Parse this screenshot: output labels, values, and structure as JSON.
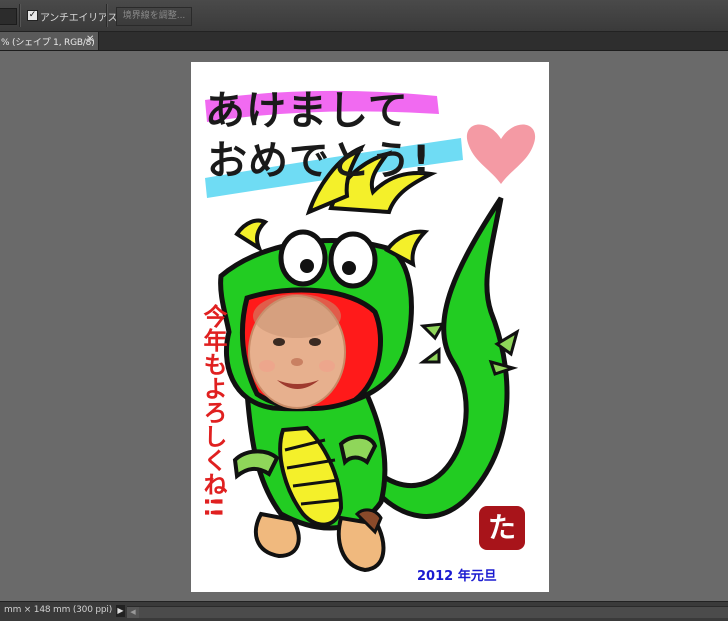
{
  "options_bar": {
    "antialias_checked": "✓",
    "antialias_label": "アンチエイリアス",
    "refine_edge_label": "境界線を調整..."
  },
  "document_tab": {
    "title": "% (シェイプ 1, RGB/8)",
    "close": "✕"
  },
  "card": {
    "greeting_line1": "あけまして",
    "greeting_line2": "おめでとう!",
    "vertical_text": "今年もよろしくね!!",
    "date": "2012 年元旦",
    "seal_char": "た"
  },
  "status_bar": {
    "doc_info": "mm × 148 mm (300 ppi)",
    "play_glyph": "▶",
    "scroll_arrow": "◀"
  }
}
